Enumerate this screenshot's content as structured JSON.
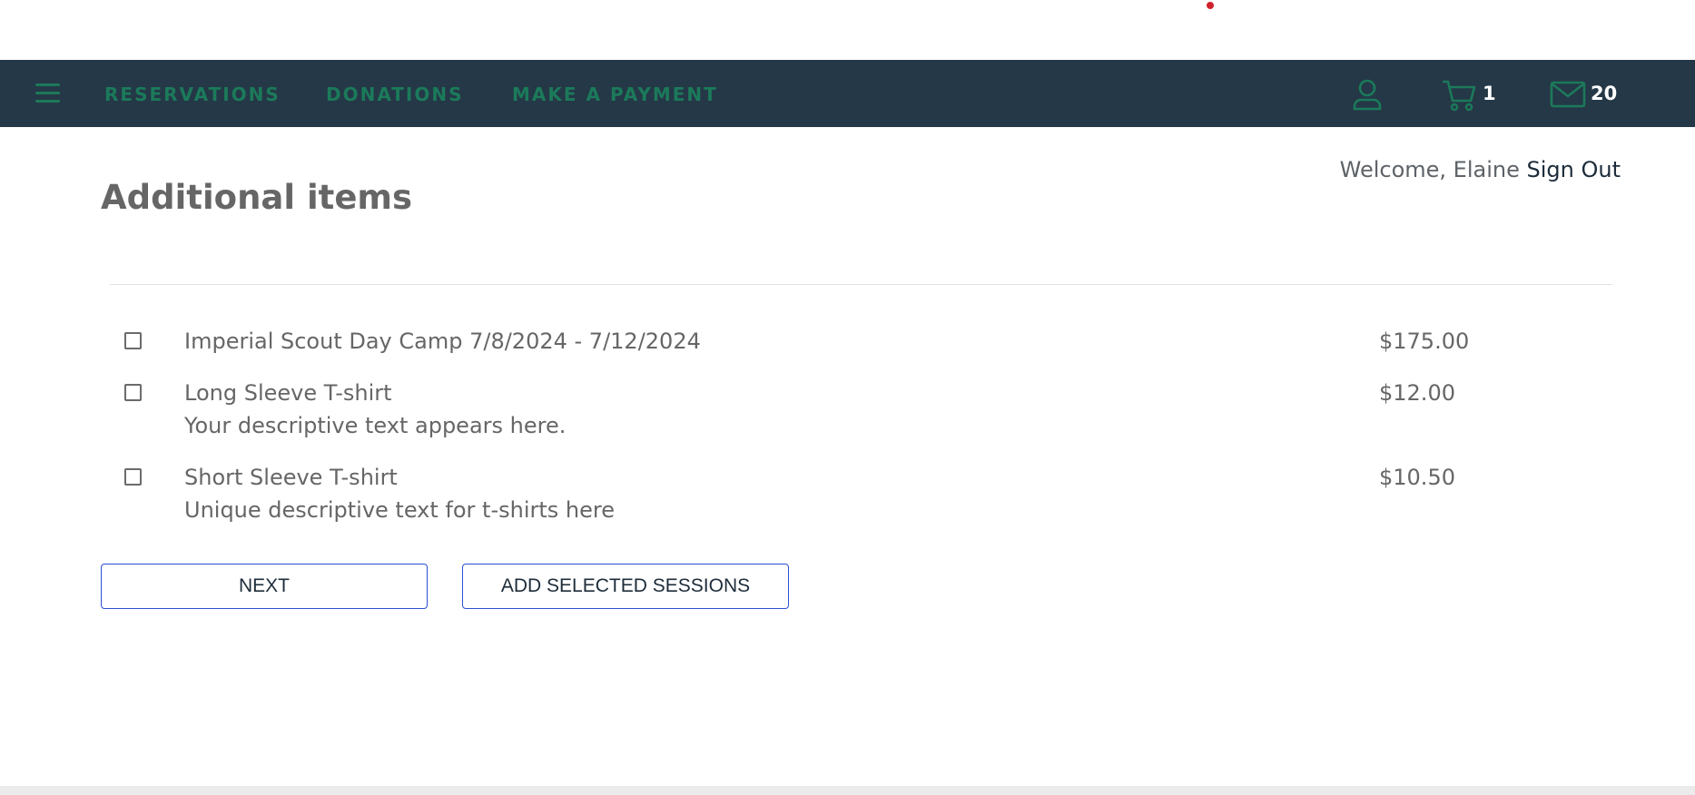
{
  "colors": {
    "navbar_bg": "#253847",
    "nav_link": "#1b7a5a",
    "nav_icon": "#1b7a5a",
    "hamburger": "#1b7a5a",
    "indicator_dot": "#d0212b",
    "button_border": "#2a4fd6"
  },
  "nav": {
    "menu_icon": "hamburger-menu-icon",
    "links": [
      "RESERVATIONS",
      "DONATIONS",
      "MAKE A PAYMENT"
    ],
    "icons": {
      "account": "user-icon",
      "cart": "cart-icon",
      "messages": "mail-icon"
    },
    "cart_count": "1",
    "message_count": "20"
  },
  "user": {
    "welcome": "Welcome, Elaine",
    "sign_out": "Sign Out"
  },
  "page": {
    "title": "Additional items"
  },
  "items": [
    {
      "name": "Imperial Scout Day Camp 7/8/2024 - 7/12/2024",
      "description": "",
      "price": "$175.00",
      "checked": false
    },
    {
      "name": "Long Sleeve T-shirt",
      "description": "Your descriptive text appears here.",
      "price": "$12.00",
      "checked": false
    },
    {
      "name": "Short Sleeve T-shirt",
      "description": "Unique descriptive text for t-shirts here",
      "price": "$10.50",
      "checked": false
    }
  ],
  "buttons": {
    "next": "NEXT",
    "add_selected": "ADD SELECTED SESSIONS"
  }
}
